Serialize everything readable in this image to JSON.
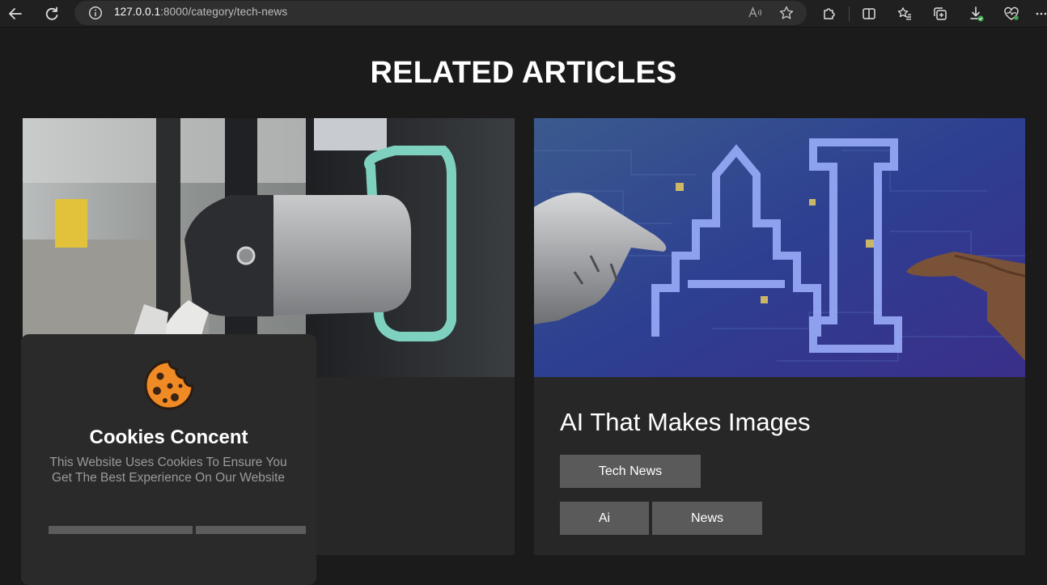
{
  "browser": {
    "url_host": "127.0.0.1",
    "url_rest": ":8000/category/tech-news",
    "icons": [
      "back-arrow-icon",
      "reload-icon",
      "info-icon",
      "read-aloud-icon",
      "favorite-star-icon",
      "extensions-icon",
      "split-screen-icon",
      "favorites-list-icon",
      "collections-icon",
      "downloads-icon",
      "browser-essentials-icon",
      "more-menu-icon"
    ]
  },
  "section": {
    "title": "RELATED ARTICLES"
  },
  "articles": [
    {
      "title": "",
      "tags": []
    },
    {
      "title": "AI That Makes Images",
      "tags": [
        "Tech News",
        "Ai",
        "News"
      ]
    }
  ],
  "cookie": {
    "title": "Cookies Concent",
    "text": "This Website Uses Cookies To Ensure You Get The Best Experience On Our Website",
    "accept_label": "",
    "decline_label": ""
  },
  "colors": {
    "background": "#1b1b1b",
    "card": "#272727",
    "tag": "#5a5a5a",
    "cookie_icon": "#f08a24"
  }
}
